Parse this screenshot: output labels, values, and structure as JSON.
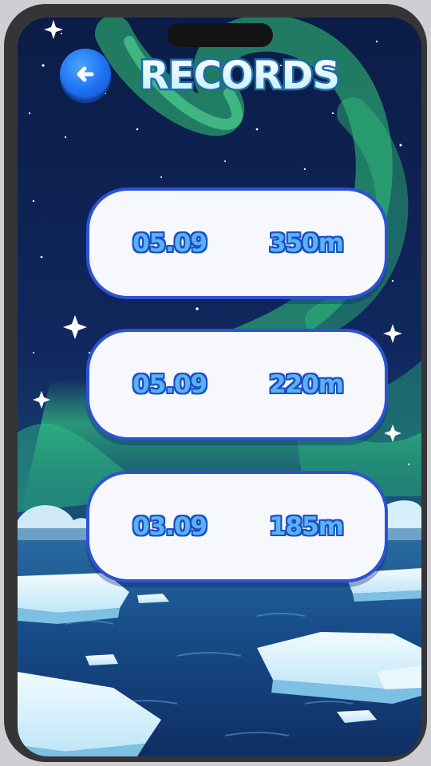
{
  "header": {
    "title": "RECORDS",
    "back_icon": "back-arrow-icon"
  },
  "records": [
    {
      "date": "05.09",
      "distance": "350m"
    },
    {
      "date": "05.09",
      "distance": "220m"
    },
    {
      "date": "03.09",
      "distance": "185m"
    }
  ],
  "colors": {
    "card_border": "#2c52d6",
    "card_fill": "#f6f8fd",
    "text_fill": "#5ab2f5",
    "text_outline": "#1b4fc4",
    "title_fill": "#e8fbff",
    "title_outline": "#1f6aa8"
  }
}
